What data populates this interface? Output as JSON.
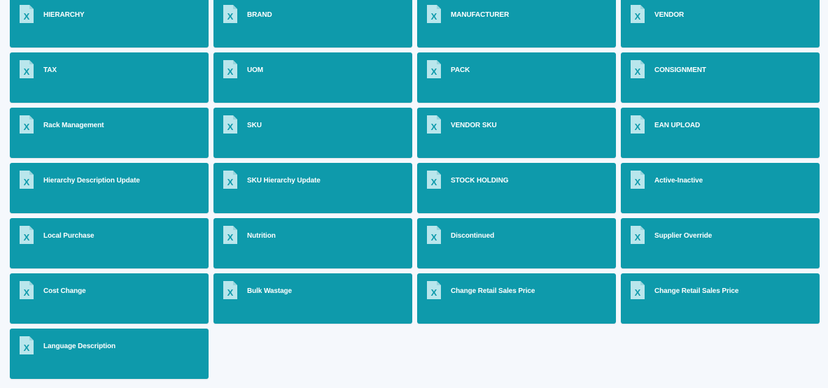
{
  "colors": {
    "background": "#f5f8fc",
    "card": "#0e9aab",
    "icon": "#b9e6ec",
    "label": "#ffffff"
  },
  "tiles": [
    {
      "label": "HIERARCHY",
      "icon": "excel-file-icon"
    },
    {
      "label": "BRAND",
      "icon": "excel-file-icon"
    },
    {
      "label": "MANUFACTURER",
      "icon": "excel-file-icon"
    },
    {
      "label": "VENDOR",
      "icon": "excel-file-icon"
    },
    {
      "label": "TAX",
      "icon": "excel-file-icon"
    },
    {
      "label": "UOM",
      "icon": "excel-file-icon"
    },
    {
      "label": "PACK",
      "icon": "excel-file-icon"
    },
    {
      "label": "CONSIGNMENT",
      "icon": "excel-file-icon"
    },
    {
      "label": "Rack Management",
      "icon": "excel-file-icon"
    },
    {
      "label": "SKU",
      "icon": "excel-file-icon"
    },
    {
      "label": "VENDOR SKU",
      "icon": "excel-file-icon"
    },
    {
      "label": "EAN UPLOAD",
      "icon": "excel-file-icon"
    },
    {
      "label": "Hierarchy Description Update",
      "icon": "excel-file-icon"
    },
    {
      "label": "SKU Hierarchy Update",
      "icon": "excel-file-icon"
    },
    {
      "label": "STOCK HOLDING",
      "icon": "excel-file-icon"
    },
    {
      "label": "Active-Inactive",
      "icon": "excel-file-icon"
    },
    {
      "label": "Local Purchase",
      "icon": "excel-file-icon"
    },
    {
      "label": "Nutrition",
      "icon": "excel-file-icon"
    },
    {
      "label": "Discontinued",
      "icon": "excel-file-icon"
    },
    {
      "label": "Supplier Override",
      "icon": "excel-file-icon"
    },
    {
      "label": "Cost Change",
      "icon": "excel-file-icon"
    },
    {
      "label": "Bulk Wastage",
      "icon": "excel-file-icon"
    },
    {
      "label": "Change Retail Sales Price",
      "icon": "excel-file-icon"
    },
    {
      "label": "Change Retail Sales Price",
      "icon": "excel-file-icon"
    },
    {
      "label": "Language Description",
      "icon": "excel-file-icon"
    }
  ]
}
